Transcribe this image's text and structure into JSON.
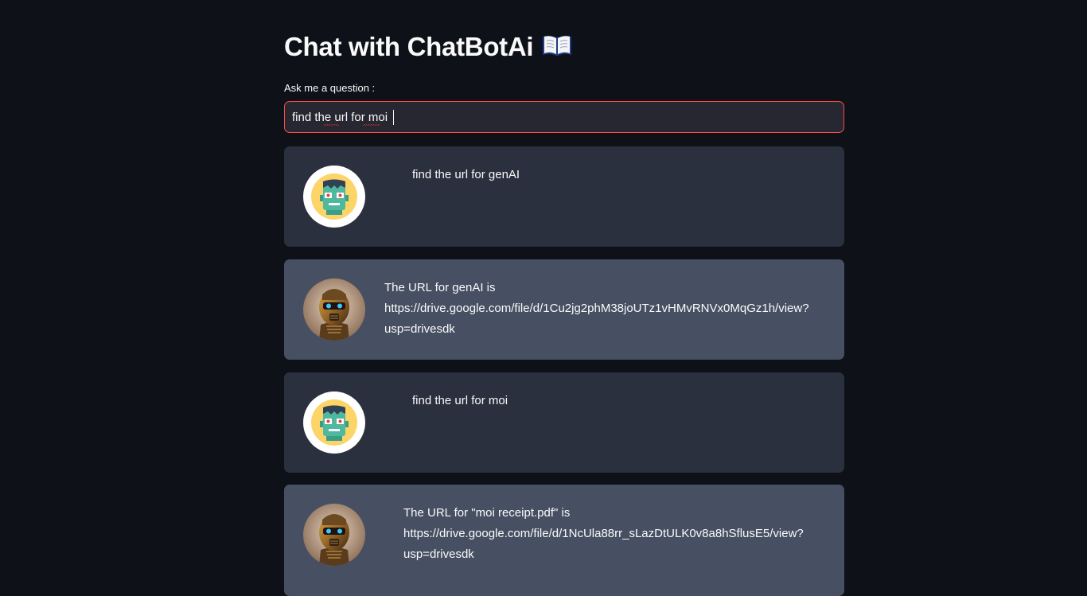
{
  "app": {
    "title": "Chat with ChatBotAi"
  },
  "input": {
    "label": "Ask me a question :",
    "value": "find the url for moi"
  },
  "messages": [
    {
      "role": "user",
      "avatar": "robot-monster-icon",
      "text": "find the url for genAI"
    },
    {
      "role": "bot",
      "avatar": "gold-robot-avatar",
      "text": "The URL for genAI is\nhttps://drive.google.com/file/d/1Cu2jg2phM38joUTz1vHMvRNVx0MqGz1h/view?\nusp=drivesdk"
    },
    {
      "role": "user",
      "avatar": "robot-monster-icon",
      "text": "find the url for moi"
    },
    {
      "role": "bot",
      "avatar": "gold-robot-avatar",
      "text": "The URL for \"moi receipt.pdf\" is\nhttps://drive.google.com/file/d/1NcUla88rr_sLazDtULK0v8a8hSflusE5/view?\nusp=drivesdk"
    }
  ],
  "colors": {
    "background": "#0e1117",
    "user_bubble": "#2b303e",
    "bot_bubble": "#475063",
    "input_focus_border": "#ff4b4b"
  }
}
